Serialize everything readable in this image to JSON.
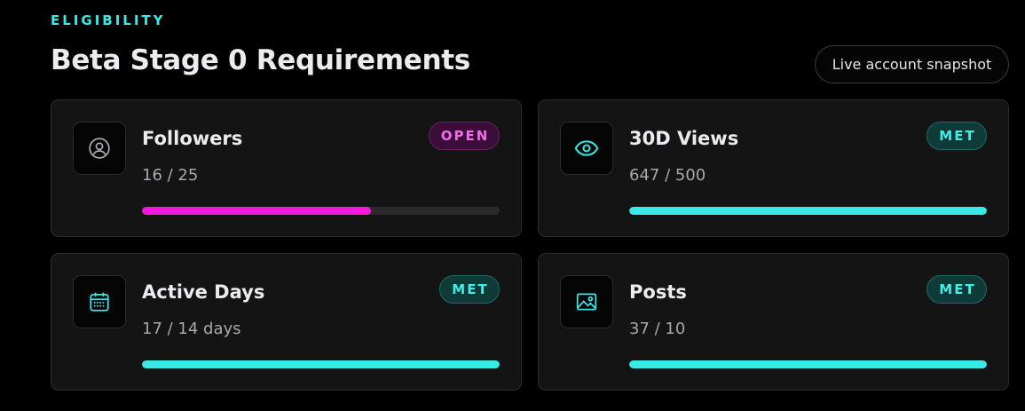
{
  "header": {
    "eyebrow": "ELIGIBILITY",
    "title": "Beta Stage 0 Requirements",
    "snapshot_button": "Live account snapshot"
  },
  "colors": {
    "accent_cyan": "#3be8e8",
    "accent_pink": "#f01ad8",
    "background": "#000000",
    "card": "#141414"
  },
  "requirements": [
    {
      "label": "Followers",
      "value": "16 / 25",
      "status": "OPEN",
      "progress": 0.64,
      "icon": "user-circle-icon"
    },
    {
      "label": "30D Views",
      "value": "647 / 500",
      "status": "MET",
      "progress": 1.0,
      "icon": "eye-icon"
    },
    {
      "label": "Active Days",
      "value": "17 / 14 days",
      "status": "MET",
      "progress": 1.0,
      "icon": "calendar-icon"
    },
    {
      "label": "Posts",
      "value": "37 / 10",
      "status": "MET",
      "progress": 1.0,
      "icon": "image-icon"
    }
  ]
}
